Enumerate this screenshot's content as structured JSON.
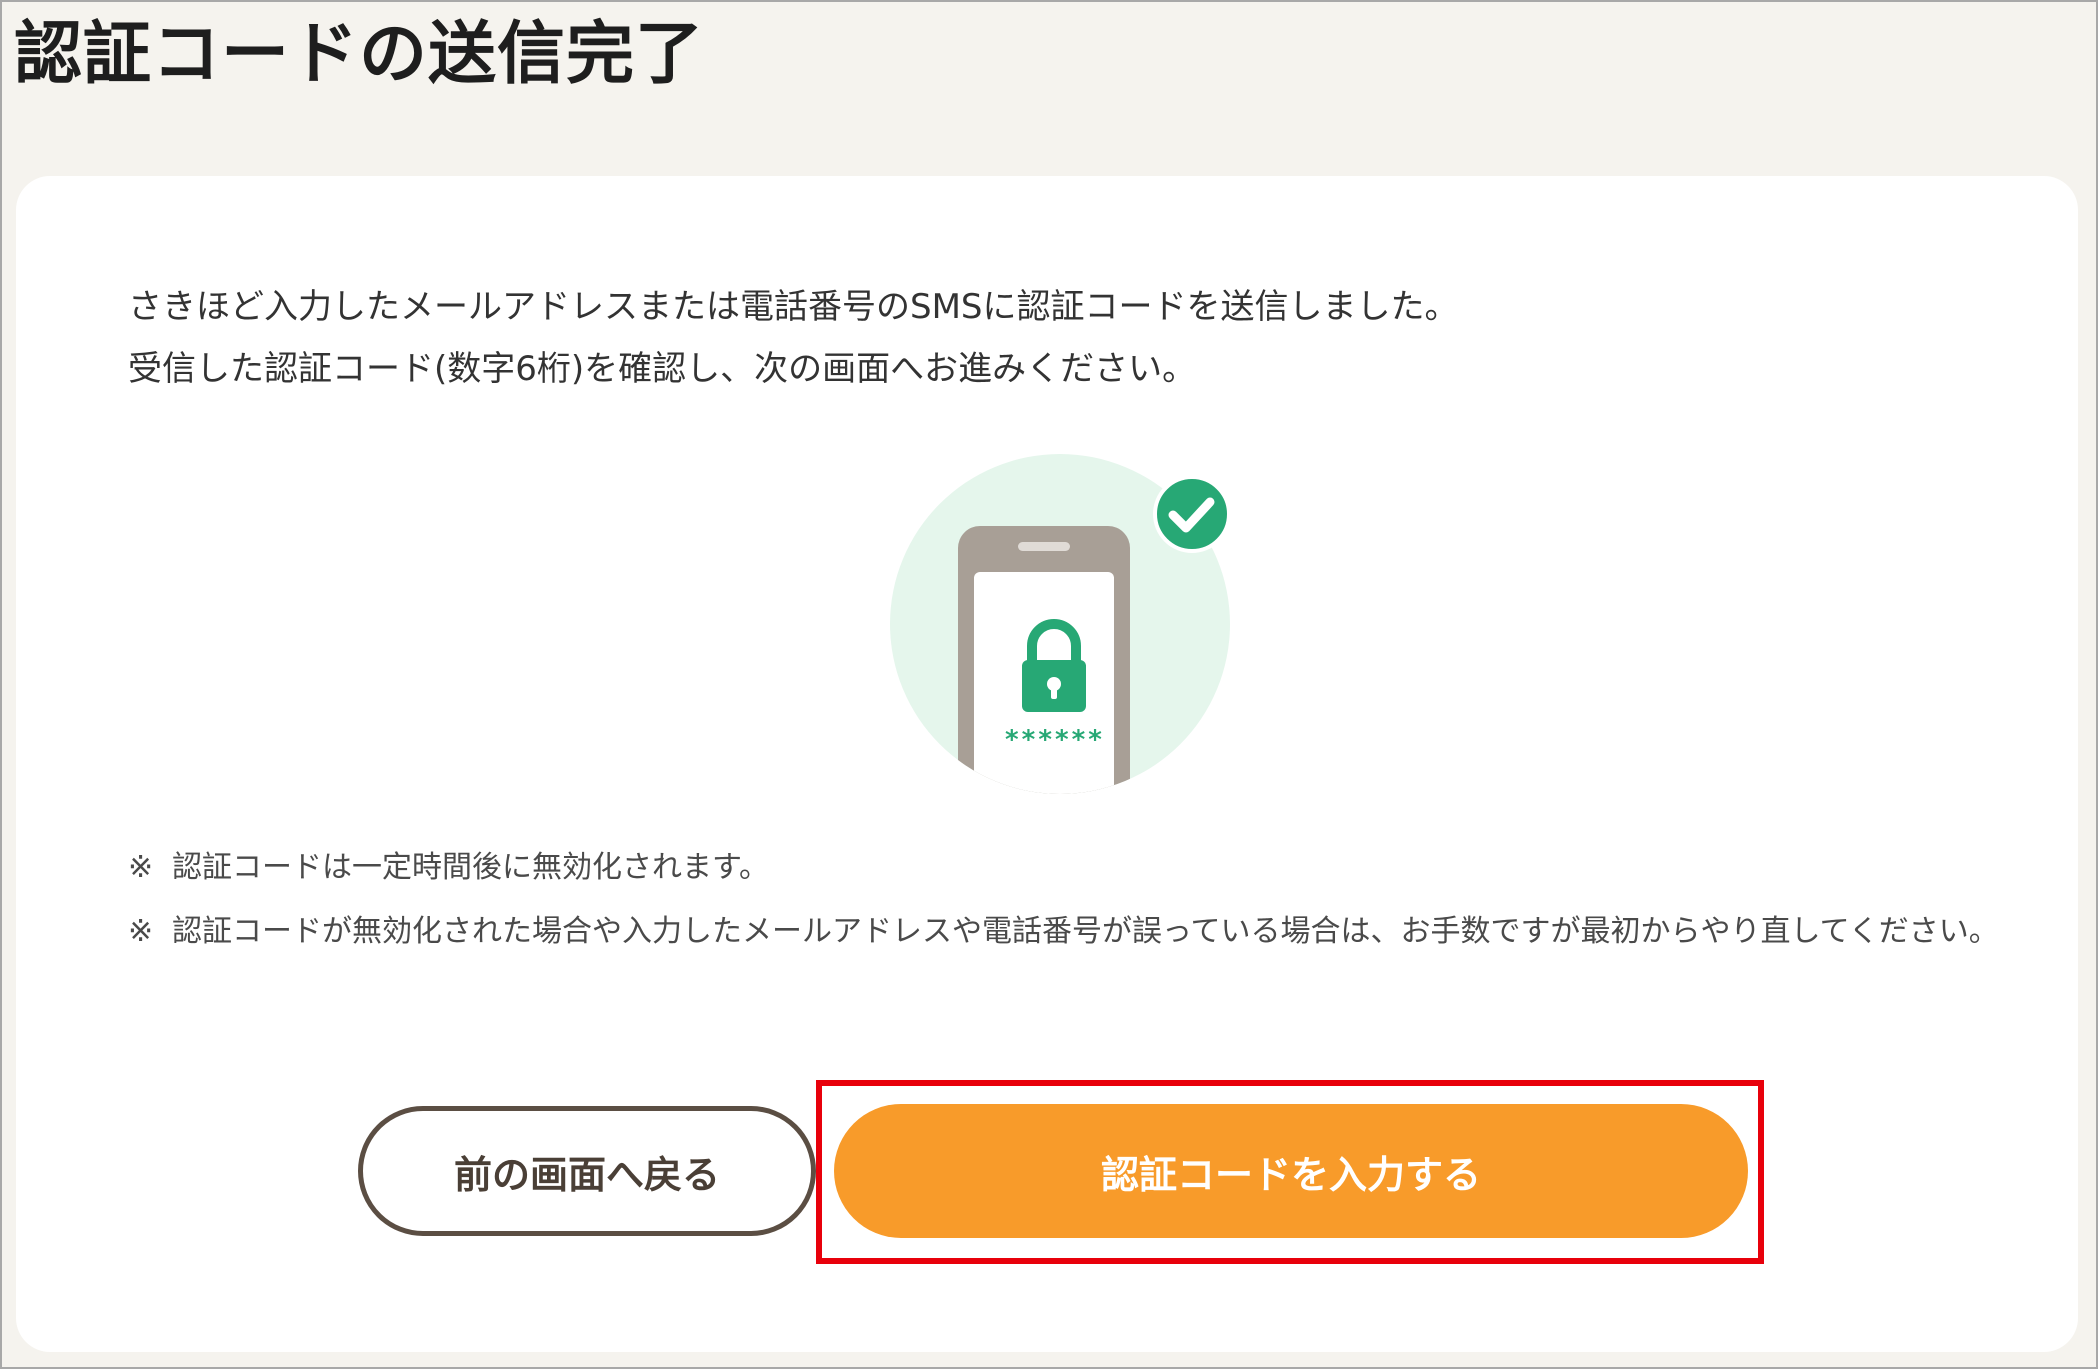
{
  "header": {
    "title": "認証コードの送信完了"
  },
  "message": {
    "line1": "さきほど入力したメールアドレスまたは電話番号のSMSに認証コードを送信しました。",
    "line2": "受信した認証コード(数字6桁)を確認し、次の画面へお進みください。"
  },
  "illustration": {
    "icons": [
      "smartphone-icon",
      "lock-icon",
      "check-badge-icon"
    ],
    "code_mask": "******"
  },
  "notes": [
    {
      "mark": "※",
      "text": "認証コードは一定時間後に無効化されます。"
    },
    {
      "mark": "※",
      "text": "認証コードが無効化された場合や入力したメールアドレスや電話番号が誤っている場合は、お手数ですが最初からやり直してください。"
    }
  ],
  "actions": {
    "back_label": "前の画面へ戻る",
    "enter_code_label": "認証コードを入力する"
  },
  "colors": {
    "accent": "#f89b2a",
    "success": "#27a875",
    "highlight": "#e8000b",
    "background": "#f5f3ee",
    "back_border": "#5b4e43"
  }
}
